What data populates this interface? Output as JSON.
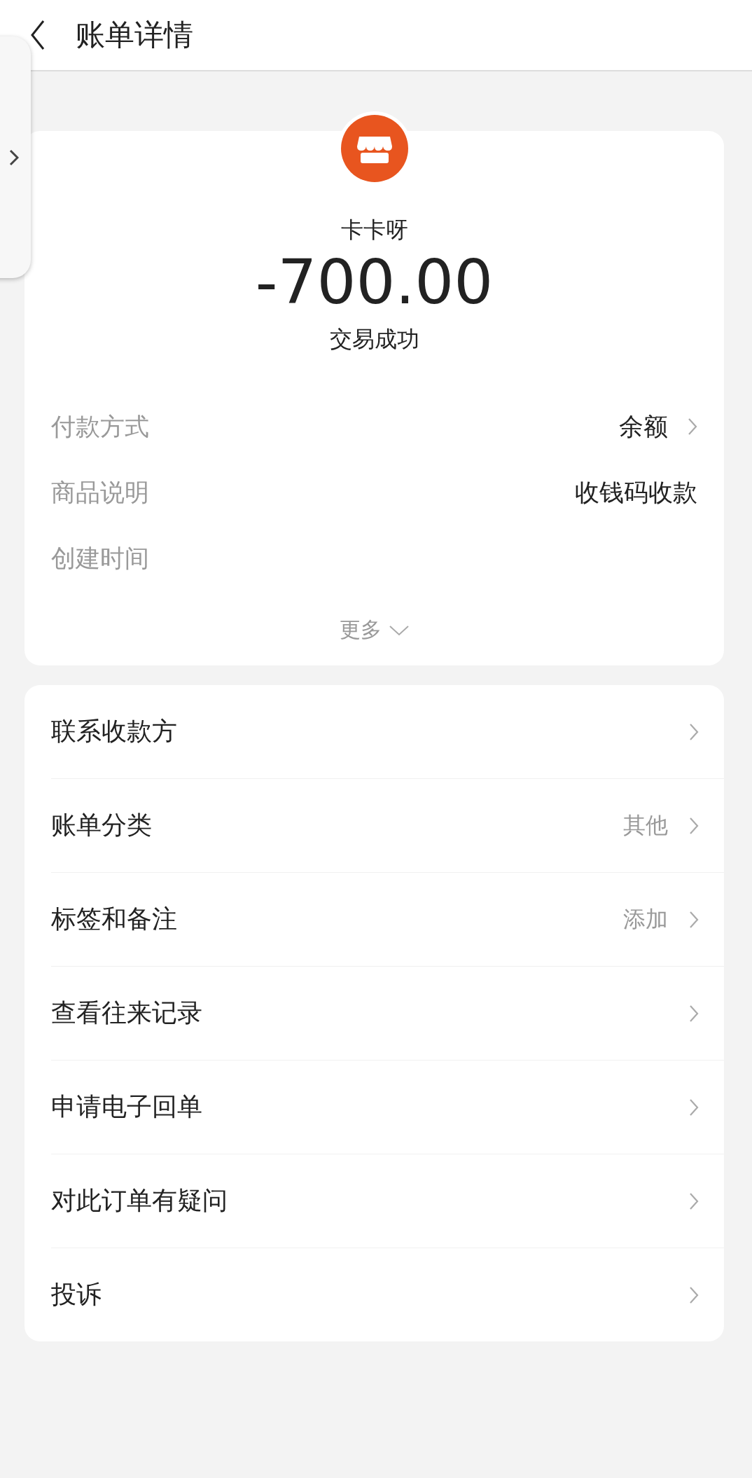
{
  "header": {
    "title": "账单详情"
  },
  "merchant": {
    "name": "卡卡呀",
    "amount": "-700.00",
    "status": "交易成功"
  },
  "details": [
    {
      "label": "付款方式",
      "value": "余额",
      "link": true
    },
    {
      "label": "商品说明",
      "value": "收钱码收款",
      "link": false
    },
    {
      "label": "创建时间",
      "link": false
    }
  ],
  "more": "更多",
  "actions": [
    {
      "label": "联系收款方"
    },
    {
      "label": "账单分类",
      "value": "其他"
    },
    {
      "label": "标签和备注",
      "value": "添加"
    },
    {
      "label": "查看往来记录"
    },
    {
      "label": "申请电子回单"
    },
    {
      "label": "对此订单有疑问"
    },
    {
      "label": "投诉"
    }
  ]
}
